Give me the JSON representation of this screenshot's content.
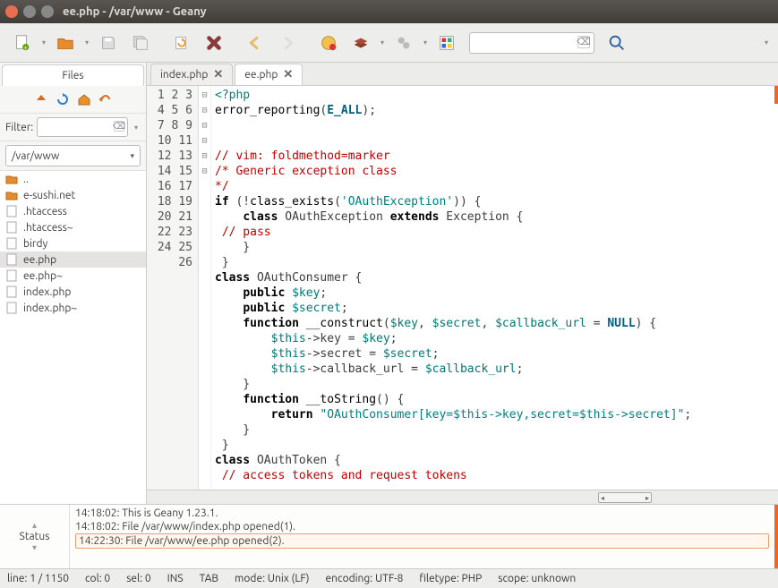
{
  "window": {
    "title": "ee.php - /var/www - Geany"
  },
  "toolbar": {
    "search_placeholder": ""
  },
  "sidebar": {
    "tab_label": "Files",
    "filter_label": "Filter:",
    "path": "/var/www",
    "files": [
      {
        "name": "..",
        "type": "folder-up"
      },
      {
        "name": "e-sushi.net",
        "type": "folder"
      },
      {
        "name": ".htaccess",
        "type": "file"
      },
      {
        "name": ".htaccess~",
        "type": "file"
      },
      {
        "name": "birdy",
        "type": "file"
      },
      {
        "name": "ee.php",
        "type": "file",
        "selected": true
      },
      {
        "name": "ee.php~",
        "type": "file"
      },
      {
        "name": "index.php",
        "type": "file"
      },
      {
        "name": "index.php~",
        "type": "file"
      }
    ]
  },
  "editor": {
    "tabs": [
      {
        "label": "index.php",
        "active": false
      },
      {
        "label": "ee.php",
        "active": true
      }
    ],
    "first_line": 1,
    "last_line": 26
  },
  "messages": {
    "status_label": "Status",
    "lines": [
      "14:18:02: This is Geany 1.23.1.",
      "14:18:02: File /var/www/index.php opened(1).",
      "14:22:30: File /var/www/ee.php opened(2)."
    ]
  },
  "statusbar": {
    "pos": "line: 1 / 1150",
    "col": "col: 0",
    "sel": "sel: 0",
    "ins": "INS",
    "tab": "TAB",
    "mode": "mode: Unix (LF)",
    "encoding": "encoding: UTF-8",
    "filetype": "filetype: PHP",
    "scope": "scope: unknown"
  }
}
